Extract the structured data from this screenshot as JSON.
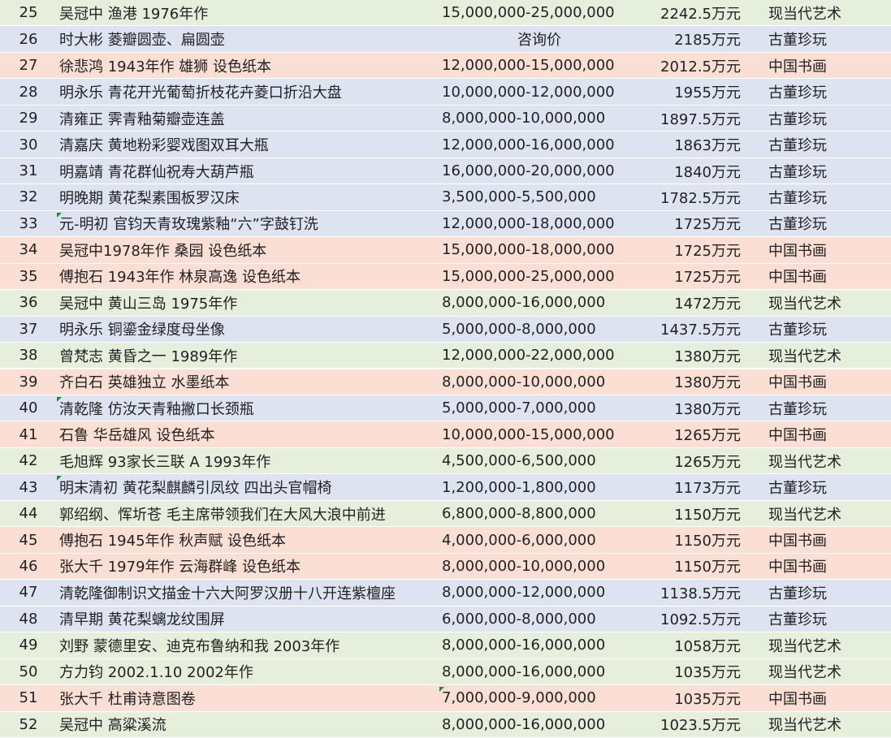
{
  "colors": {
    "现当代艺术": "#e5efdb",
    "古董珍玩": "#dde3f1",
    "中国书画": "#fbded4",
    "marker": "#1f8a3a"
  },
  "rows": [
    {
      "rank": "25",
      "name": "吴冠中 渔港 1976年作",
      "estimate": "15,000,000-25,000,000",
      "price": "2242.5万元",
      "category": "现当代艺术"
    },
    {
      "rank": "26",
      "name": "时大彬  菱瓣圆壶、扁圆壶",
      "estimate": "咨询价",
      "price": "2185万元",
      "category": "古董珍玩"
    },
    {
      "rank": "27",
      "name": "徐悲鸿 1943年作 雄狮 设色纸本",
      "estimate": "12,000,000-15,000,000",
      "price": "2012.5万元",
      "category": "中国书画"
    },
    {
      "rank": "28",
      "name": "明永乐 青花开光葡萄折枝花卉菱口折沿大盘",
      "estimate": "10,000,000-12,000,000",
      "price": "1955万元",
      "category": "古董珍玩"
    },
    {
      "rank": "29",
      "name": "清雍正 霁青釉菊瓣壶连盖",
      "estimate": "8,000,000-10,000,000",
      "price": "1897.5万元",
      "category": "古董珍玩"
    },
    {
      "rank": "30",
      "name": "清嘉庆 黄地粉彩婴戏图双耳大瓶",
      "estimate": "12,000,000-16,000,000",
      "price": "1863万元",
      "category": "古董珍玩"
    },
    {
      "rank": "31",
      "name": "明嘉靖 青花群仙祝寿大葫芦瓶",
      "estimate": "16,000,000-20,000,000",
      "price": "1840万元",
      "category": "古董珍玩"
    },
    {
      "rank": "32",
      "name": "明晚期 黄花梨素围板罗汉床",
      "estimate": "3,500,000-5,500,000",
      "price": "1782.5万元",
      "category": "古董珍玩"
    },
    {
      "rank": "33",
      "name": "元-明初 官钧天青玫瑰紫釉“六”字鼓钉洗",
      "estimate": "12,000,000-18,000,000",
      "price": "1725万元",
      "category": "古董珍玩",
      "mark": true
    },
    {
      "rank": "34",
      "name": "吴冠中1978年作 桑园 设色纸本",
      "estimate": "15,000,000-18,000,000",
      "price": "1725万元",
      "category": "中国书画"
    },
    {
      "rank": "35",
      "name": "傅抱石 1943年作 林泉高逸 设色纸本",
      "estimate": "15,000,000-25,000,000",
      "price": "1725万元",
      "category": "中国书画"
    },
    {
      "rank": "36",
      "name": "吴冠中 黄山三岛 1975年作",
      "estimate": "8,000,000-16,000,000",
      "price": "1472万元",
      "category": "现当代艺术"
    },
    {
      "rank": "37",
      "name": "明永乐 铜鎏金绿度母坐像",
      "estimate": "5,000,000-8,000,000",
      "price": "1437.5万元",
      "category": "古董珍玩"
    },
    {
      "rank": "38",
      "name": "曾梵志 黄昏之一 1989年作",
      "estimate": "12,000,000-22,000,000",
      "price": "1380万元",
      "category": "现当代艺术"
    },
    {
      "rank": "39",
      "name": "齐白石 英雄独立 水墨纸本",
      "estimate": "8,000,000-10,000,000",
      "price": "1380万元",
      "category": "中国书画"
    },
    {
      "rank": "40",
      "name": "清乾隆 仿汝天青釉撇口长颈瓶",
      "estimate": "5,000,000-7,000,000",
      "price": "1380万元",
      "category": "古董珍玩",
      "mark": true
    },
    {
      "rank": "41",
      "name": "石鲁 华岳雄风 设色纸本",
      "estimate": "10,000,000-15,000,000",
      "price": "1265万元",
      "category": "中国书画"
    },
    {
      "rank": "42",
      "name": "毛旭辉 93家长三联 A 1993年作",
      "estimate": "4,500,000-6,500,000",
      "price": "1265万元",
      "category": "现当代艺术"
    },
    {
      "rank": "43",
      "name": "明末清初 黄花梨麒麟引凤纹 四出头官帽椅",
      "estimate": "1,200,000-1,800,000",
      "price": "1173万元",
      "category": "古董珍玩",
      "mark": true
    },
    {
      "rank": "44",
      "name": "郭绍纲、恽圻苍 毛主席带领我们在大风大浪中前进",
      "estimate": "6,800,000-8,800,000",
      "price": "1150万元",
      "category": "现当代艺术"
    },
    {
      "rank": "45",
      "name": "傅抱石 1945年作 秋声赋 设色纸本",
      "estimate": "4,000,000-6,000,000",
      "price": "1150万元",
      "category": "中国书画"
    },
    {
      "rank": "46",
      "name": "张大千 1979年作 云海群峰 设色纸本",
      "estimate": "8,000,000-10,000,000",
      "price": "1150万元",
      "category": "中国书画"
    },
    {
      "rank": "47",
      "name": "清乾隆御制识文描金十六大阿罗汉册十八开连紫檀座",
      "estimate": "8,000,000-12,000,000",
      "price": "1138.5万元",
      "category": "古董珍玩"
    },
    {
      "rank": "48",
      "name": "清早期 黄花梨螭龙纹围屏",
      "estimate": "6,000,000-8,000,000",
      "price": "1092.5万元",
      "category": "古董珍玩"
    },
    {
      "rank": "49",
      "name": "刘野 蒙德里安、迪克布鲁纳和我 2003年作",
      "estimate": "8,000,000-16,000,000",
      "price": "1058万元",
      "category": "现当代艺术"
    },
    {
      "rank": "50",
      "name": "方力钧 2002.1.10 2002年作",
      "estimate": "8,000,000-16,000,000",
      "price": "1035万元",
      "category": "现当代艺术"
    },
    {
      "rank": "51",
      "name": "张大千 杜甫诗意图卷",
      "estimate": "7,000,000-9,000,000",
      "price": "1035万元",
      "category": "中国书画",
      "mark_est": true
    },
    {
      "rank": "52",
      "name": "吴冠中 高粱溪流",
      "estimate": "8,000,000-16,000,000",
      "price": "1023.5万元",
      "category": "现当代艺术"
    }
  ]
}
